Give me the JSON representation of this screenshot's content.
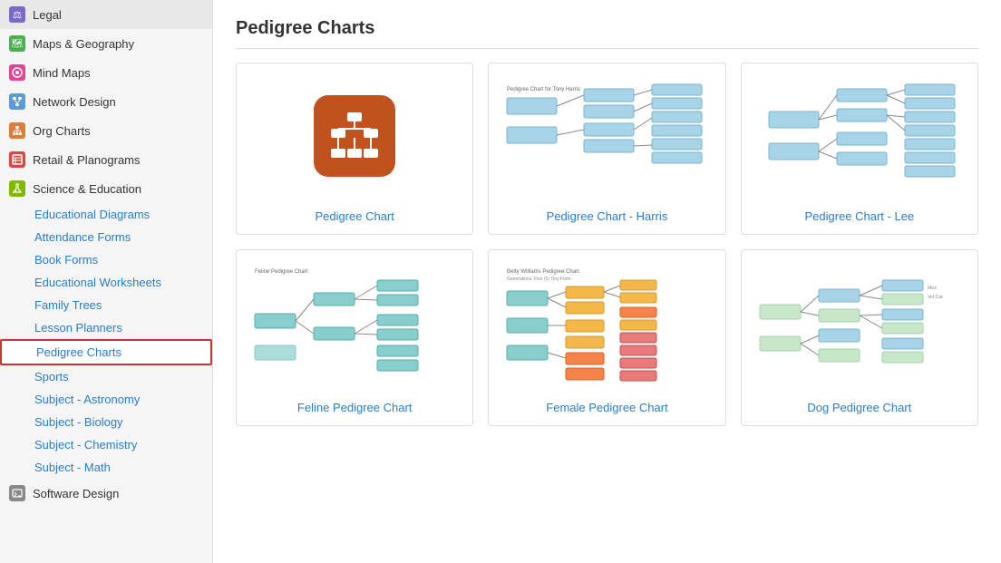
{
  "sidebar": {
    "items": [
      {
        "id": "legal",
        "label": "Legal",
        "iconColor": "#7b68c8",
        "iconChar": "⚖"
      },
      {
        "id": "maps",
        "label": "Maps & Geography",
        "iconColor": "#4caf50",
        "iconChar": "🗺"
      },
      {
        "id": "mind",
        "label": "Mind Maps",
        "iconColor": "#e84393",
        "iconChar": "✦"
      },
      {
        "id": "network",
        "label": "Network Design",
        "iconColor": "#5c9bd6",
        "iconChar": "⬡"
      },
      {
        "id": "org",
        "label": "Org Charts",
        "iconColor": "#e07b39",
        "iconChar": "▦"
      },
      {
        "id": "retail",
        "label": "Retail & Planograms",
        "iconColor": "#d44444",
        "iconChar": "▤"
      },
      {
        "id": "science",
        "label": "Science & Education",
        "iconColor": "#7fba00",
        "iconChar": "⚗"
      }
    ],
    "subItems": [
      {
        "id": "educational-diagrams",
        "label": "Educational Diagrams",
        "active": false
      },
      {
        "id": "attendance-forms",
        "label": "Attendance Forms",
        "active": false
      },
      {
        "id": "book-forms",
        "label": "Book Forms",
        "active": false
      },
      {
        "id": "educational-worksheets",
        "label": "Educational Worksheets",
        "active": false
      },
      {
        "id": "family-trees",
        "label": "Family Trees",
        "active": false
      },
      {
        "id": "lesson-planners",
        "label": "Lesson Planners",
        "active": false
      },
      {
        "id": "pedigree-charts",
        "label": "Pedigree Charts",
        "active": true
      },
      {
        "id": "sports",
        "label": "Sports",
        "active": false
      },
      {
        "id": "subject-astronomy",
        "label": "Subject - Astronomy",
        "active": false
      },
      {
        "id": "subject-biology",
        "label": "Subject - Biology",
        "active": false
      },
      {
        "id": "subject-chemistry",
        "label": "Subject - Chemistry",
        "active": false
      },
      {
        "id": "subject-math",
        "label": "Subject - Math",
        "active": false
      }
    ],
    "softwareDesign": {
      "label": "Software Design",
      "iconColor": "#888",
      "iconChar": "◧"
    }
  },
  "main": {
    "title": "Pedigree Charts",
    "cards": [
      {
        "id": "pedigree-chart",
        "label": "Pedigree Chart",
        "type": "icon"
      },
      {
        "id": "pedigree-harris",
        "label": "Pedigree Chart - Harris",
        "type": "chart-blue"
      },
      {
        "id": "pedigree-lee",
        "label": "Pedigree Chart - Lee",
        "type": "chart-blue2"
      },
      {
        "id": "feline-pedigree",
        "label": "Feline Pedigree Chart",
        "type": "chart-teal"
      },
      {
        "id": "female-pedigree",
        "label": "Female Pedigree Chart",
        "type": "chart-colorful"
      },
      {
        "id": "dog-pedigree",
        "label": "Dog Pedigree Chart",
        "type": "chart-green"
      }
    ]
  }
}
